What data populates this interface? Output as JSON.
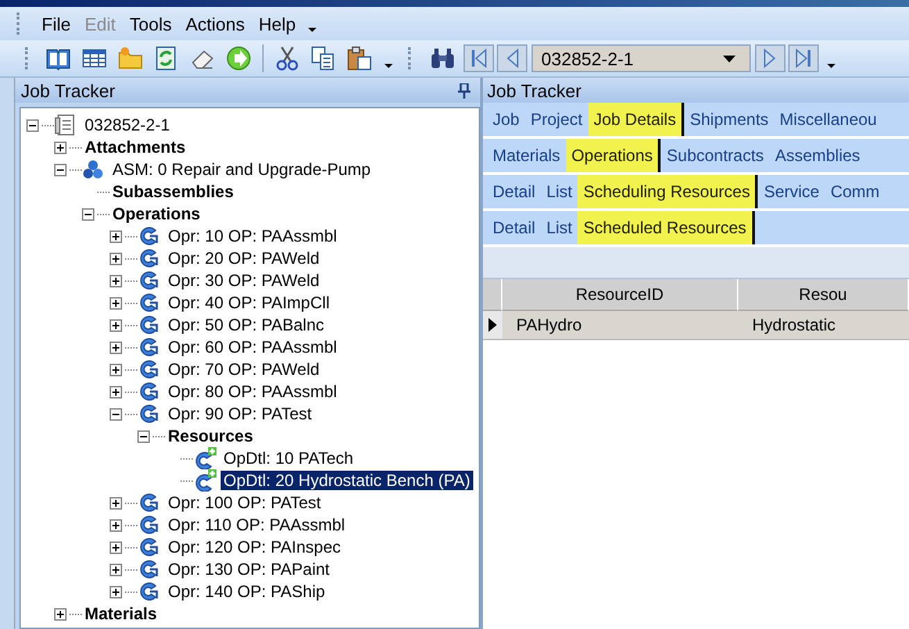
{
  "menu": [
    {
      "label": "File",
      "disabled": false
    },
    {
      "label": "Edit",
      "disabled": true
    },
    {
      "label": "Tools",
      "disabled": false
    },
    {
      "label": "Actions",
      "disabled": false
    },
    {
      "label": "Help",
      "disabled": false
    }
  ],
  "toolbar": {
    "job_field": "032852-2-1"
  },
  "tree_panel": {
    "title": "Job Tracker"
  },
  "tree": [
    {
      "label": "032852-2-1",
      "kind": "job",
      "expanded": true,
      "selected": false,
      "children": [
        {
          "label": "Attachments",
          "kind": "heading",
          "expanded": false,
          "selected": false
        },
        {
          "label": "ASM: 0 Repair and Upgrade-Pump",
          "kind": "assembly",
          "expanded": true,
          "selected": false,
          "children": [
            {
              "label": "Subassemblies",
              "kind": "heading",
              "selected": false
            },
            {
              "label": "Operations",
              "kind": "heading",
              "expanded": true,
              "selected": false,
              "children": [
                {
                  "label": "Opr: 10 OP: PAAssmbl",
                  "kind": "operation",
                  "expanded": false,
                  "selected": false
                },
                {
                  "label": "Opr: 20 OP: PAWeld",
                  "kind": "operation",
                  "expanded": false,
                  "selected": false
                },
                {
                  "label": "Opr: 30 OP: PAWeld",
                  "kind": "operation",
                  "expanded": false,
                  "selected": false
                },
                {
                  "label": "Opr: 40 OP: PAImpCll",
                  "kind": "operation",
                  "expanded": false,
                  "selected": false
                },
                {
                  "label": "Opr: 50 OP: PABalnc",
                  "kind": "operation",
                  "expanded": false,
                  "selected": false
                },
                {
                  "label": "Opr: 60 OP: PAAssmbl",
                  "kind": "operation",
                  "expanded": false,
                  "selected": false
                },
                {
                  "label": "Opr: 70 OP: PAWeld",
                  "kind": "operation",
                  "expanded": false,
                  "selected": false
                },
                {
                  "label": "Opr: 80 OP: PAAssmbl",
                  "kind": "operation",
                  "expanded": false,
                  "selected": false
                },
                {
                  "label": "Opr: 90 OP: PATest",
                  "kind": "operation",
                  "expanded": true,
                  "selected": false,
                  "children": [
                    {
                      "label": "Resources",
                      "kind": "heading",
                      "expanded": true,
                      "selected": false,
                      "children": [
                        {
                          "label": "OpDtl: 10 PATech",
                          "kind": "detail",
                          "selected": false
                        },
                        {
                          "label": "OpDtl: 20 Hydrostatic Bench (PA)",
                          "kind": "detail",
                          "selected": true
                        }
                      ]
                    }
                  ]
                },
                {
                  "label": "Opr: 100 OP: PATest",
                  "kind": "operation",
                  "expanded": false,
                  "selected": false
                },
                {
                  "label": "Opr: 110 OP: PAAssmbl",
                  "kind": "operation",
                  "expanded": false,
                  "selected": false
                },
                {
                  "label": "Opr: 120 OP: PAInspec",
                  "kind": "operation",
                  "expanded": false,
                  "selected": false
                },
                {
                  "label": "Opr: 130 OP: PAPaint",
                  "kind": "operation",
                  "expanded": false,
                  "selected": false
                },
                {
                  "label": "Opr: 140 OP: PAShip",
                  "kind": "operation",
                  "expanded": false,
                  "selected": false
                }
              ]
            }
          ]
        },
        {
          "label": "Materials",
          "kind": "heading",
          "expanded": false,
          "selected": false
        }
      ]
    }
  ],
  "detail_panel": {
    "title": "Job Tracker"
  },
  "tab_rows": [
    [
      {
        "label": "Job",
        "selected": false
      },
      {
        "label": "Project",
        "selected": false
      },
      {
        "label": "Job Details",
        "selected": true
      },
      {
        "label": "Shipments",
        "selected": false
      },
      {
        "label": "Miscellaneou",
        "selected": false
      }
    ],
    [
      {
        "label": "Materials",
        "selected": false
      },
      {
        "label": "Operations",
        "selected": true
      },
      {
        "label": "Subcontracts",
        "selected": false
      },
      {
        "label": "Assemblies",
        "selected": false
      }
    ],
    [
      {
        "label": "Detail",
        "selected": false
      },
      {
        "label": "List",
        "selected": false
      },
      {
        "label": "Scheduling Resources",
        "selected": true
      },
      {
        "label": "Service",
        "selected": false
      },
      {
        "label": "Comm",
        "selected": false
      }
    ],
    [
      {
        "label": "Detail",
        "selected": false
      },
      {
        "label": "List",
        "selected": false
      },
      {
        "label": "Scheduled Resources",
        "selected": true
      }
    ]
  ],
  "grid": {
    "columns": [
      "ResourceID",
      "Resou"
    ],
    "rows": [
      {
        "cells": [
          "PAHydro",
          "Hydrostatic"
        ],
        "selected": true
      }
    ]
  }
}
